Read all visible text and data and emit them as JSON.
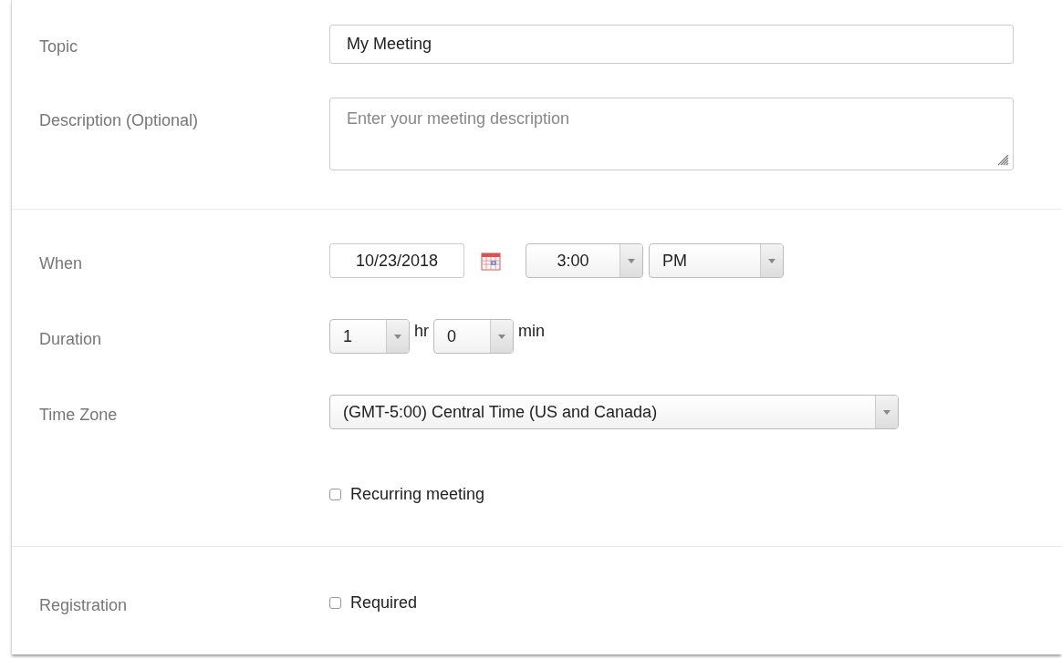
{
  "sections": [
    {
      "fields": [
        {
          "kind": "text",
          "label": "Topic",
          "value": "My Meeting"
        },
        {
          "kind": "textarea",
          "label": "Description (Optional)",
          "placeholder": "Enter your meeting description"
        }
      ]
    },
    {
      "fields": [
        {
          "kind": "when",
          "label": "When",
          "date": "10/23/2018",
          "time": "3:00",
          "period": "PM"
        },
        {
          "kind": "duration",
          "label": "Duration",
          "hours": "1",
          "hours_unit": "hr",
          "minutes": "0",
          "minutes_unit": "min"
        },
        {
          "kind": "select",
          "label": "Time Zone",
          "value": "(GMT-5:00) Central Time (US and Canada)"
        },
        {
          "kind": "checkbox",
          "text": "Recurring meeting",
          "checked": false
        }
      ]
    },
    {
      "fields": [
        {
          "kind": "checkbox",
          "label": "Registration",
          "text": "Required",
          "checked": false
        }
      ]
    }
  ]
}
